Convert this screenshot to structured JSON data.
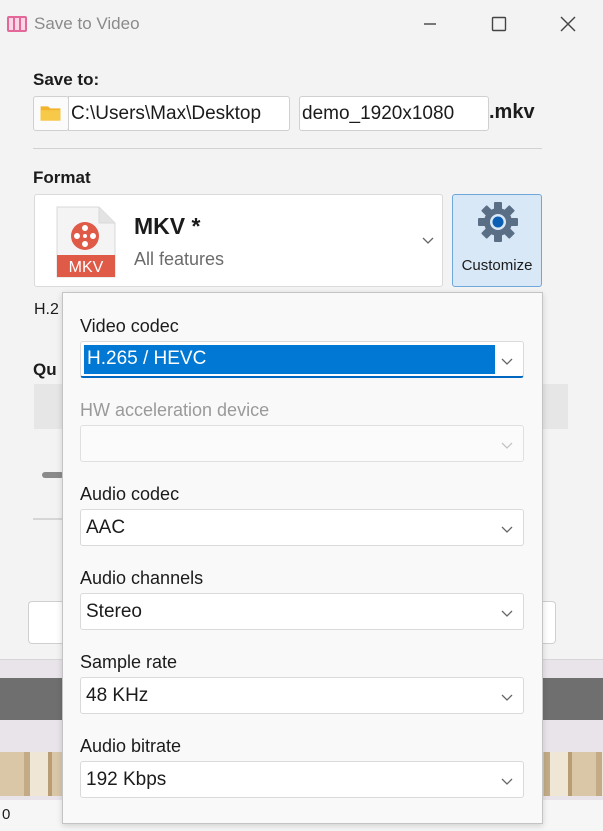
{
  "window": {
    "title": "Save to Video",
    "icon": "film-icon"
  },
  "save_to": {
    "label": "Save to:",
    "folder_icon": "folder-icon",
    "path": "C:\\Users\\Max\\Desktop",
    "filename": "demo_1920x1080",
    "extension": ".mkv"
  },
  "format": {
    "label": "Format",
    "icon_text": "MKV",
    "name": "MKV *",
    "subtitle": "All features",
    "customize_label": "Customize"
  },
  "background": {
    "codec_fragment": "H.2",
    "quality_fragment": "Qu",
    "status_text": "0"
  },
  "customize_popup": {
    "fields": [
      {
        "label": "Video codec",
        "value": "H.265 / HEVC",
        "state": "selected"
      },
      {
        "label": "HW acceleration device",
        "value": "",
        "state": "disabled"
      },
      {
        "label": "Audio codec",
        "value": "AAC",
        "state": "normal"
      },
      {
        "label": "Audio channels",
        "value": "Stereo",
        "state": "normal"
      },
      {
        "label": "Sample rate",
        "value": "48 KHz",
        "state": "normal"
      },
      {
        "label": "Audio bitrate",
        "value": "192 Kbps",
        "state": "normal"
      }
    ]
  },
  "colors": {
    "accent": "#0078d4",
    "customize_bg": "#d8e8f7",
    "mkv_red": "#e05a48"
  }
}
